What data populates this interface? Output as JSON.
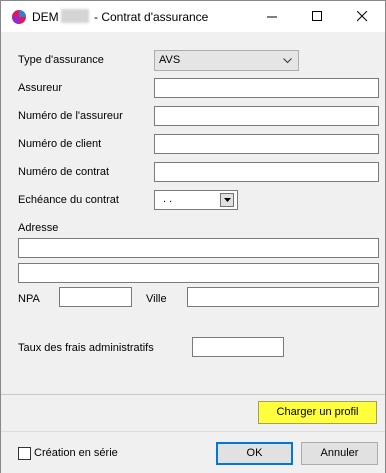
{
  "window": {
    "title_prefix": "DEM",
    "title_suffix": " - Contrat d'assurance"
  },
  "form": {
    "insurance_type_label": "Type d'assurance",
    "insurance_type_value": "AVS",
    "insurer_label": "Assureur",
    "insurer_number_label": "Numéro de l'assureur",
    "client_number_label": "Numéro de client",
    "contract_number_label": "Numéro de contrat",
    "contract_expiry_label": "Echéance du contrat",
    "contract_expiry_value": ". .",
    "address_label": "Adresse",
    "npa_label": "NPA",
    "city_label": "Ville",
    "admin_fee_rate_label": "Taux des frais administratifs"
  },
  "footer": {
    "load_profile_label": "Charger un profil",
    "serial_creation_label": "Création en série",
    "ok_label": "OK",
    "cancel_label": "Annuler"
  }
}
